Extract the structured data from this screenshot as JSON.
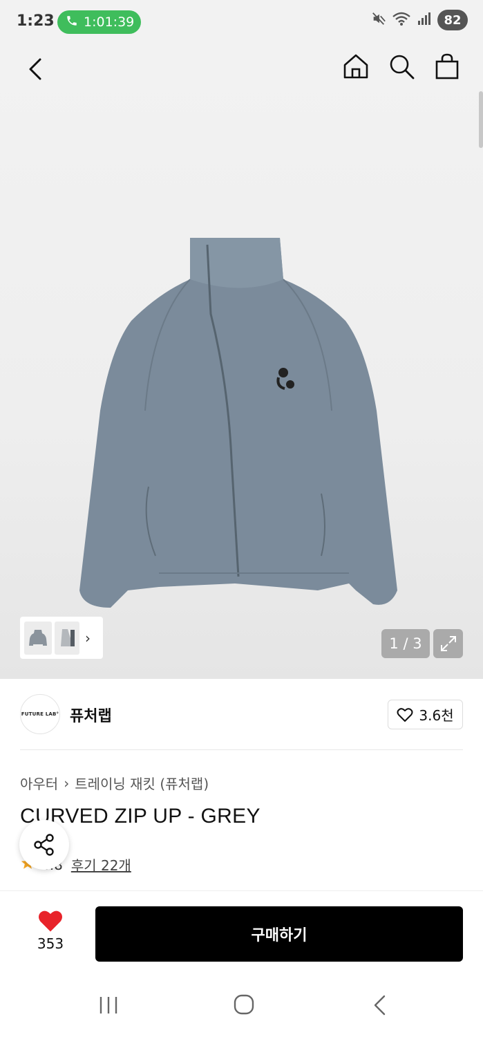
{
  "status_bar": {
    "time": "1:23",
    "call_duration": "1:01:39",
    "battery": "82",
    "icons": [
      "phone-icon",
      "mute-icon",
      "wifi-icon",
      "signal-icon"
    ]
  },
  "header": {
    "icons": [
      "back-arrow-icon",
      "home-icon",
      "search-icon",
      "shopping-bag-icon"
    ]
  },
  "gallery": {
    "page_indicator": "1 / 3",
    "current_page": 1,
    "total_pages": 3
  },
  "brand": {
    "logo_text": "FUTURE LAB°",
    "name": "퓨처랩",
    "like_count": "3.6천"
  },
  "product": {
    "breadcrumb": [
      "아우터",
      "트레이닝 재킷 (퓨처랩)"
    ],
    "title": "CURVED ZIP UP - GREY",
    "rating": "4.8",
    "reviews": "후기 22개"
  },
  "bottom_bar": {
    "like_count": "353",
    "buy_label": "구매하기"
  },
  "colors": {
    "accent_green": "#3fbd5c",
    "heart_red": "#e8232a",
    "star_orange": "#f5a623",
    "buy_button": "#000000",
    "jacket_grey": "#7a8a9a"
  }
}
